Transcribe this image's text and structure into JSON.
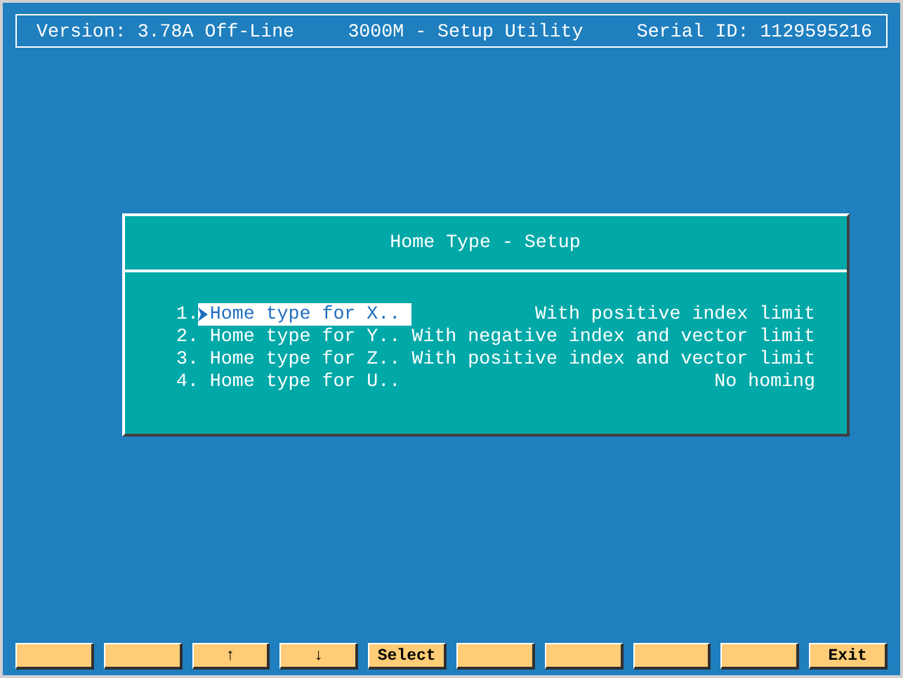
{
  "header": {
    "version": "Version: 3.78A Off-Line",
    "title": "3000M - Setup Utility",
    "serial": "Serial ID: 1129595216"
  },
  "dialog": {
    "title": "Home Type - Setup",
    "items": [
      {
        "number": "1.",
        "label": "Home type for X..",
        "value": "With positive index limit",
        "selected": true
      },
      {
        "number": "2.",
        "label": "Home type for Y..",
        "value": "With negative index and vector limit",
        "selected": false
      },
      {
        "number": "3.",
        "label": "Home type for Z..",
        "value": "With positive index and vector limit",
        "selected": false
      },
      {
        "number": "4.",
        "label": "Home type for U..",
        "value": "No homing",
        "selected": false
      }
    ]
  },
  "function_keys": [
    {
      "kind": "blank"
    },
    {
      "kind": "blank"
    },
    {
      "kind": "label",
      "label": "↑"
    },
    {
      "kind": "label",
      "label": "↓"
    },
    {
      "kind": "label",
      "label": "Select"
    },
    {
      "kind": "blank"
    },
    {
      "kind": "blank"
    },
    {
      "kind": "blank"
    },
    {
      "kind": "blank"
    },
    {
      "kind": "label",
      "label": "Exit"
    }
  ]
}
